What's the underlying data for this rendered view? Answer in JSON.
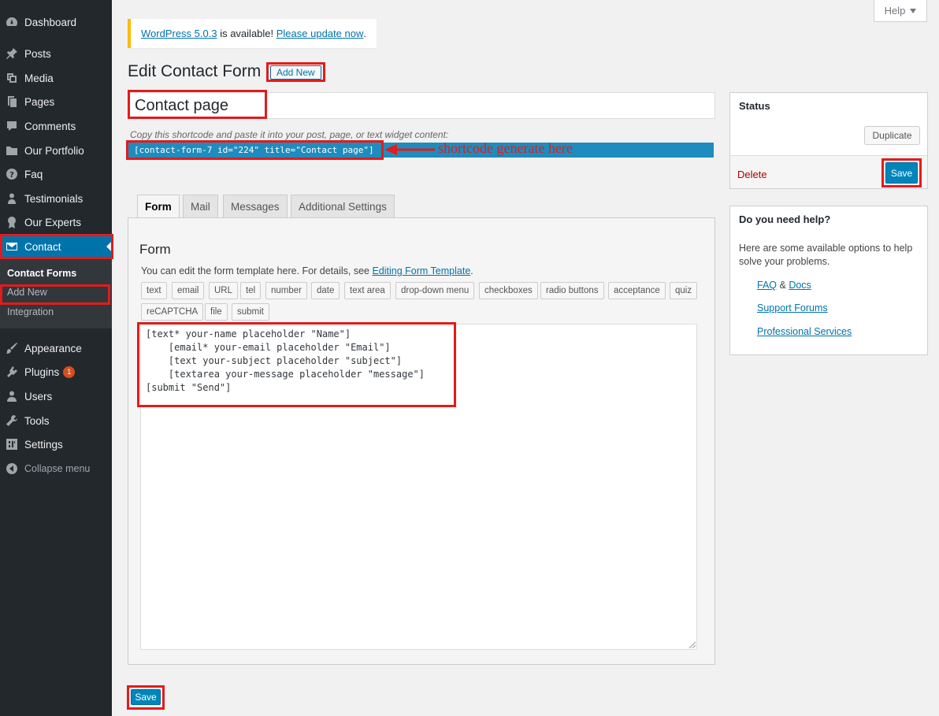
{
  "sidebar": {
    "items": [
      {
        "label": "Dashboard",
        "icon": "dashboard-icon"
      },
      {
        "label": "Posts",
        "icon": "pin-icon"
      },
      {
        "label": "Media",
        "icon": "media-icon"
      },
      {
        "label": "Pages",
        "icon": "pages-icon"
      },
      {
        "label": "Comments",
        "icon": "comment-icon"
      },
      {
        "label": "Our Portfolio",
        "icon": "folder-icon"
      },
      {
        "label": "Faq",
        "icon": "help-circle-icon"
      },
      {
        "label": "Testimonials",
        "icon": "person-icon"
      },
      {
        "label": "Our Experts",
        "icon": "award-icon"
      },
      {
        "label": "Contact",
        "icon": "envelope-icon"
      },
      {
        "label": "Appearance",
        "icon": "brush-icon"
      },
      {
        "label": "Plugins",
        "icon": "plugin-icon",
        "badge": "1"
      },
      {
        "label": "Users",
        "icon": "users-icon"
      },
      {
        "label": "Tools",
        "icon": "wrench-icon"
      },
      {
        "label": "Settings",
        "icon": "settings-icon"
      },
      {
        "label": "Collapse menu",
        "icon": "collapse-icon"
      }
    ],
    "submenu": [
      "Contact Forms",
      "Add New",
      "Integration"
    ]
  },
  "help_tab": {
    "label": "Help"
  },
  "notice": {
    "version_link": "WordPress 5.0.3",
    "middle": " is available! ",
    "update_link": "Please update now",
    "end": "."
  },
  "header": {
    "title": "Edit Contact Form",
    "add_new": "Add New"
  },
  "form_title": {
    "value": "Contact page"
  },
  "shortcode": {
    "hint": "Copy this shortcode and paste it into your post, page, or text widget content:",
    "code": "[contact-form-7 id=\"224\" title=\"Contact page\"]",
    "annotation": "shortcode generate here"
  },
  "tabs": [
    "Form",
    "Mail",
    "Messages",
    "Additional Settings"
  ],
  "form_panel": {
    "heading": "Form",
    "desc_prefix": "You can edit the form template here. For details, see ",
    "desc_link": "Editing Form Template",
    "desc_suffix": ".",
    "tag_buttons": [
      "text",
      "email",
      "URL",
      "tel",
      "number",
      "date",
      "text area",
      "drop-down menu",
      "checkboxes",
      "radio buttons",
      "acceptance",
      "quiz",
      "reCAPTCHA",
      "file",
      "submit"
    ],
    "code_lines": [
      "[text* your-name placeholder \"Name\"]",
      "    [email* your-email placeholder \"Email\"]",
      "    [text your-subject placeholder \"subject\"]",
      "    [textarea your-message placeholder \"message\"]",
      "[submit \"Send\"]"
    ]
  },
  "save_bottom": "Save",
  "status_box": {
    "title": "Status",
    "duplicate": "Duplicate",
    "delete": "Delete",
    "save": "Save"
  },
  "help_box": {
    "title": "Do you need help?",
    "desc": "Here are some available options to help solve your problems.",
    "faq": "FAQ",
    "amp": " & ",
    "docs": "Docs",
    "forums": "Support Forums",
    "services": "Professional Services"
  },
  "colors": {
    "sidebar_bg": "#23282d",
    "accent": "#0073aa",
    "annotation_red": "#e31b1b",
    "notice_border": "#ffb900"
  }
}
